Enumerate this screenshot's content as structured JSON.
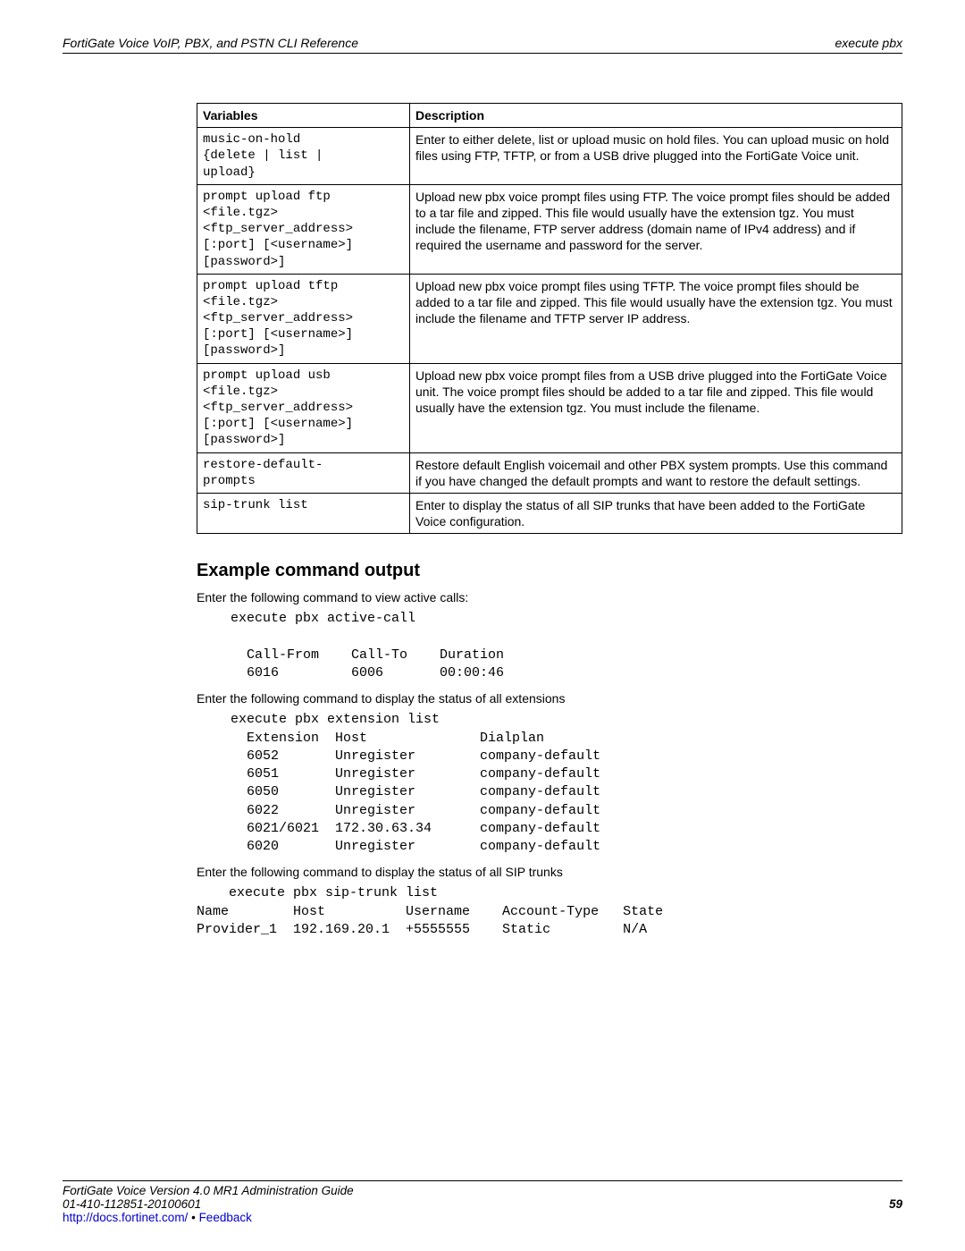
{
  "header": {
    "left": "FortiGate Voice VoIP, PBX, and PSTN CLI Reference",
    "right": "execute pbx"
  },
  "table": {
    "head_var": "Variables",
    "head_desc": "Description",
    "rows": [
      {
        "var": "music-on-hold\n{delete | list |\nupload}",
        "desc": "Enter to either delete, list or upload music on hold files. You can upload music on hold files using FTP, TFTP, or from a USB drive plugged into the FortiGate Voice unit."
      },
      {
        "var": "prompt upload ftp\n<file.tgz>\n<ftp_server_address>\n[:port] [<username>]\n[password>]",
        "desc": "Upload new pbx voice prompt files using FTP. The voice prompt files should be added to a tar file and zipped. This file would usually have the extension tgz. You must include the filename, FTP server address (domain name of IPv4 address) and if required the username and password for the server."
      },
      {
        "var": "prompt upload tftp\n<file.tgz>\n<ftp_server_address>\n[:port] [<username>]\n[password>]",
        "desc": "Upload new pbx voice prompt files using TFTP. The voice prompt files should be added to a tar file and zipped. This file would usually have the extension tgz. You must include the filename and TFTP server IP address."
      },
      {
        "var": "prompt upload usb\n<file.tgz>\n<ftp_server_address>\n[:port] [<username>]\n[password>]",
        "desc": "Upload new pbx voice prompt files from a USB drive plugged into the FortiGate Voice unit. The voice prompt files should be added to a tar file and zipped. This file would usually have the extension tgz. You must include the filename."
      },
      {
        "var": "restore-default-\nprompts",
        "desc": "Restore default English voicemail and other PBX system prompts. Use this command if you have changed the default prompts and want to restore the default settings."
      },
      {
        "var": "sip-trunk list",
        "desc": "Enter to display the status of all SIP trunks that have been added to the FortiGate Voice configuration."
      }
    ]
  },
  "section_heading": "Example command output",
  "intro1": "Enter the following command to view active calls:",
  "code1": "execute pbx active-call\n\n  Call-From    Call-To    Duration\n  6016         6006       00:00:46",
  "intro2": "Enter the following command to display the status of all extensions",
  "code2": "execute pbx extension list\n  Extension  Host              Dialplan\n  6052       Unregister        company-default\n  6051       Unregister        company-default\n  6050       Unregister        company-default\n  6022       Unregister        company-default\n  6021/6021  172.30.63.34      company-default\n  6020       Unregister        company-default",
  "intro3": "Enter the following command to display the status of all SIP trunks",
  "code3": "    execute pbx sip-trunk list\nName        Host          Username    Account-Type   State\nProvider_1  192.169.20.1  +5555555    Static         N/A",
  "footer": {
    "line1": "FortiGate Voice Version 4.0 MR1 Administration Guide",
    "line2": "01-410-112851-20100601",
    "page": "59",
    "link": "http://docs.fortinet.com/",
    "bullet": " • ",
    "feedback": "Feedback"
  }
}
